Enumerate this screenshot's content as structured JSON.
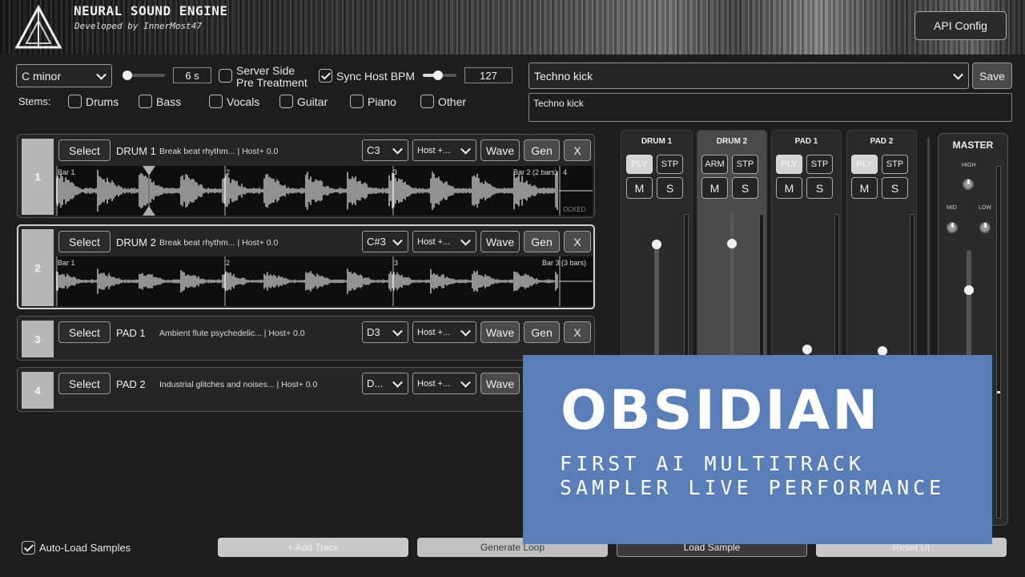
{
  "header": {
    "title": "NEURAL SOUND ENGINE",
    "subtitle": "Developed by InnerMost47",
    "api_config": "API Config"
  },
  "controls": {
    "key": "C minor",
    "duration": "6 s",
    "duration_slider_fraction": 0.05,
    "server_side": "Server Side",
    "pre_treatment": "Pre Treatment",
    "server_side_checked": false,
    "sync_host_bpm": "Sync Host BPM",
    "sync_host_bpm_checked": true,
    "bpm_slider_fraction": 0.45,
    "bpm": "127",
    "prompt_select": "Techno kick",
    "save": "Save",
    "prompt_text": "Techno kick",
    "stems_label": "Stems:",
    "stems": [
      "Drums",
      "Bass",
      "Vocals",
      "Guitar",
      "Piano",
      "Other"
    ]
  },
  "tracks": [
    {
      "number": "1",
      "select": "Select",
      "name": "DRUM 1",
      "desc": "Break beat rhythm... | Host+ 0.0",
      "note": "C3",
      "host": "Host +...",
      "wave": "Wave",
      "gen": "Gen",
      "close": "X",
      "bars": [
        "Bar 1",
        "2",
        "3",
        "Bar 2 (2 bars)",
        "4"
      ],
      "locked": "OCKED"
    },
    {
      "number": "2",
      "select": "Select",
      "name": "DRUM 2",
      "desc": "Break beat rhythm... | Host+ 0.0",
      "note": "C#3",
      "host": "Host +...",
      "wave": "Wave",
      "gen": "Gen",
      "close": "X",
      "bars": [
        "Bar 1",
        "2",
        "3",
        "Bar 3 (3 bars)"
      ]
    },
    {
      "number": "3",
      "select": "Select",
      "name": "PAD 1",
      "desc": "Ambient flute psychedelic... | Host+ 0.0",
      "note": "D3",
      "host": "Host +...",
      "wave": "Wave",
      "gen": "Gen",
      "close": "X"
    },
    {
      "number": "4",
      "select": "Select",
      "name": "PAD 2",
      "desc": "Industrial glitches and noises... | Host+ 0.0",
      "note": "D...",
      "host": "Host +...",
      "wave": "Wave"
    }
  ],
  "mixer": {
    "strips": [
      {
        "name": "DRUM 1",
        "btn1": "PLY",
        "btn2": "STP",
        "mute": "M",
        "solo": "S"
      },
      {
        "name": "DRUM 2",
        "btn1": "ARM",
        "btn2": "STP",
        "mute": "M",
        "solo": "S"
      },
      {
        "name": "PAD 1",
        "btn1": "PLY",
        "btn2": "STP",
        "mute": "M",
        "solo": "S"
      },
      {
        "name": "PAD 2",
        "btn1": "PLY",
        "btn2": "STP",
        "mute": "M",
        "solo": "S"
      }
    ],
    "master": {
      "name": "MASTER",
      "high": "HIGH",
      "mid": "MID",
      "low": "LOW"
    }
  },
  "bottom": {
    "auto_load": "Auto-Load Samples",
    "auto_load_checked": true,
    "add_track": "+ Add Track",
    "generate_loop": "Generate Loop",
    "load_sample": "Load Sample",
    "reset_ui": "Reset UI"
  },
  "overlay": {
    "title": "OBSIDIAN",
    "line1": "FIRST AI MULTITRACK",
    "line2": "SAMPLER LIVE PERFORMANCE"
  },
  "colors": {
    "background": "#1e1e1e",
    "overlay": "#5a7eb8"
  }
}
